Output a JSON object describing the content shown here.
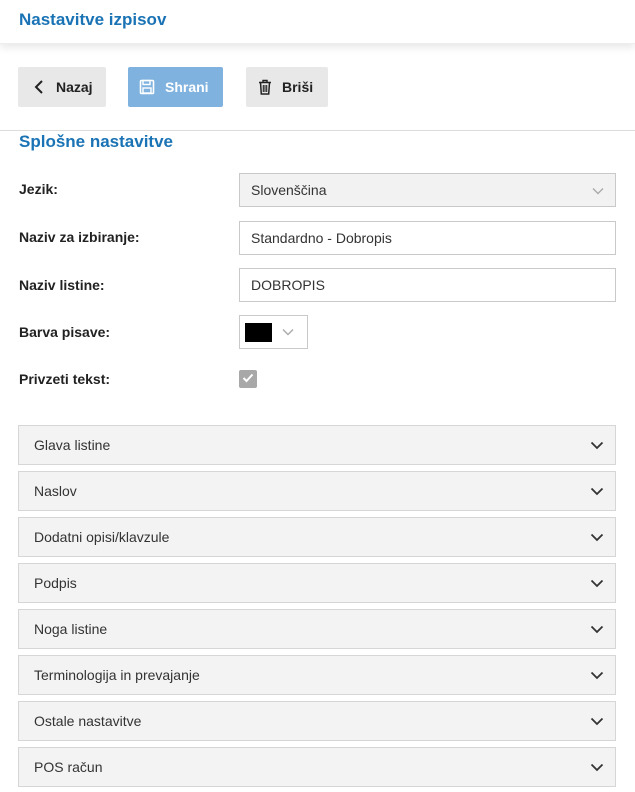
{
  "header": {
    "title": "Nastavitve izpisov"
  },
  "toolbar": {
    "back_label": "Nazaj",
    "save_label": "Shrani",
    "delete_label": "Briši"
  },
  "section": {
    "title": "Splošne nastavitve"
  },
  "form": {
    "language_label": "Jezik:",
    "language_value": "Slovenščina",
    "select_name_label": "Naziv za izbiranje:",
    "select_name_value": "Standardno - Dobropis",
    "document_name_label": "Naziv listine:",
    "document_name_value": "DOBROPIS",
    "font_color_label": "Barva pisave:",
    "font_color_value": "#000000",
    "default_text_label": "Privzeti tekst:",
    "default_text_checked": true
  },
  "accordion": [
    {
      "label": "Glava listine"
    },
    {
      "label": "Naslov"
    },
    {
      "label": "Dodatni opisi/klavzule"
    },
    {
      "label": "Podpis"
    },
    {
      "label": "Noga listine"
    },
    {
      "label": "Terminologija in prevajanje"
    },
    {
      "label": "Ostale nastavitve"
    },
    {
      "label": "POS račun"
    }
  ],
  "colors": {
    "accent": "#1a73b5",
    "save_button": "#7fb2df",
    "button_gray": "#e8e8e8",
    "accordion_bg": "#f3f3f3"
  },
  "icons": {
    "back": "chevron-left-icon",
    "save": "floppy-disk-icon",
    "delete": "trash-icon",
    "expand": "chevron-down-icon",
    "check": "check-icon"
  }
}
